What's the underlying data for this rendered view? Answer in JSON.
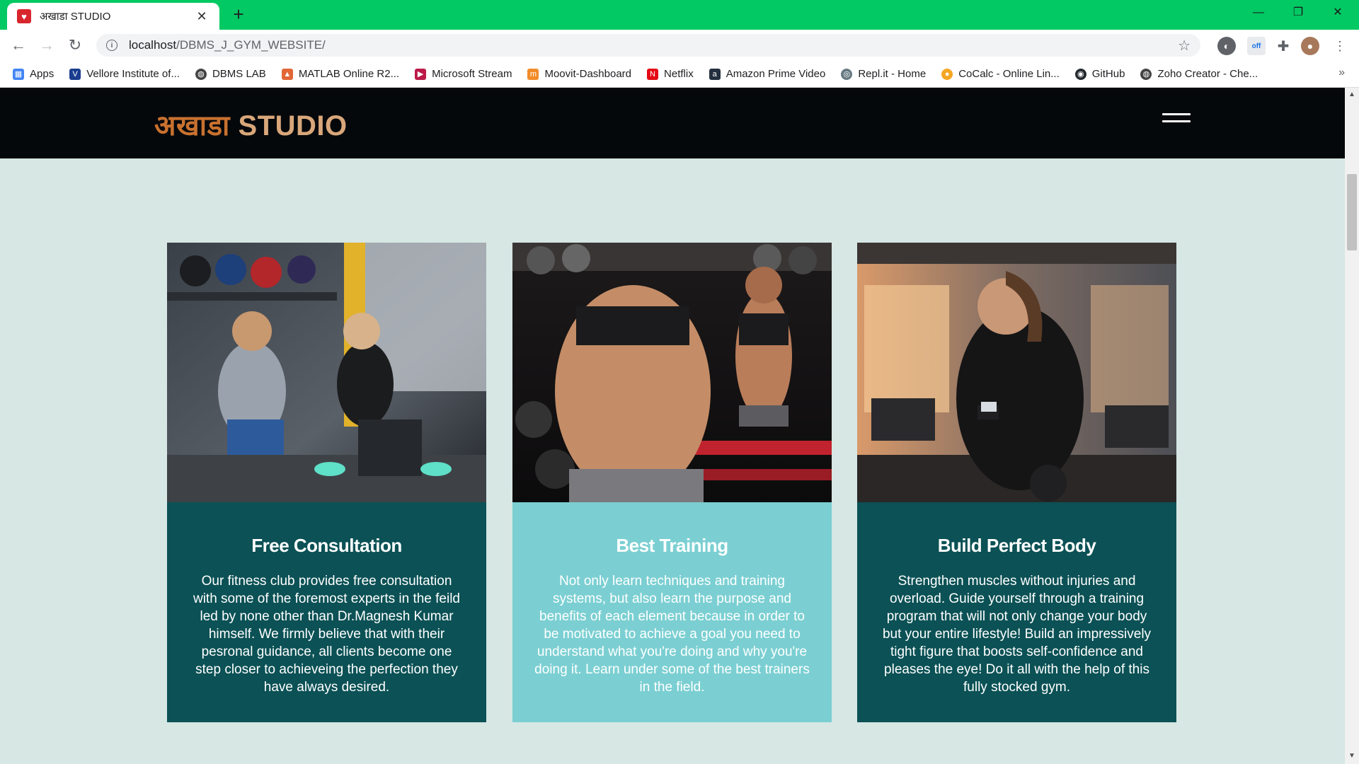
{
  "browser": {
    "tab_title": "अखाडा STUDIO",
    "tab_close": "✕",
    "new_tab": "+",
    "url_host": "localhost",
    "url_path": "/DBMS_J_GYM_WEBSITE/",
    "bookmarks": [
      {
        "label": "Apps",
        "icon": "apps-grid-icon",
        "color": "#4285f4"
      },
      {
        "label": "Vellore Institute of...",
        "icon": "vit-icon",
        "color": "#1a3d8f"
      },
      {
        "label": "DBMS LAB",
        "icon": "globe-icon",
        "color": "#444444"
      },
      {
        "label": "MATLAB Online R2...",
        "icon": "matlab-icon",
        "color": "#e16737"
      },
      {
        "label": "Microsoft Stream",
        "icon": "stream-icon",
        "color": "#bc1948"
      },
      {
        "label": "Moovit-Dashboard",
        "icon": "moovit-icon",
        "color": "#f28c28"
      },
      {
        "label": "Netflix",
        "icon": "netflix-icon",
        "color": "#e50914"
      },
      {
        "label": "Amazon Prime Video",
        "icon": "amazon-icon",
        "color": "#232f3e"
      },
      {
        "label": "Repl.it - Home",
        "icon": "replit-icon",
        "color": "#667881"
      },
      {
        "label": "CoCalc - Online Lin...",
        "icon": "cocalc-icon",
        "color": "#f5a623"
      },
      {
        "label": "GitHub",
        "icon": "github-icon",
        "color": "#24292e"
      },
      {
        "label": "Zoho Creator - Che...",
        "icon": "globe-icon",
        "color": "#444444"
      }
    ],
    "bookmarks_more": "»"
  },
  "site": {
    "logo_hindi": "अखाडा",
    "logo_studio": "STUDIO",
    "cards": [
      {
        "title": "Free Consultation",
        "text": "Our fitness club provides free consultation with some of the foremost experts in the feild led by none other than Dr.Magnesh Kumar himself. We firmly believe that with their pesronal guidance, all clients become one step closer to achieveing the perfection they have always desired.",
        "theme": "dark"
      },
      {
        "title": "Best Training",
        "text": "Not only learn techniques and training systems, but also learn the purpose and benefits of each element because in order to be motivated to achieve a goal you need to understand what you're doing and why you're doing it. Learn under some of the best trainers in the field.",
        "theme": "light"
      },
      {
        "title": "Build Perfect Body",
        "text": "Strengthen muscles without injuries and overload. Guide yourself through a training program that will not only change your body but your entire lifestyle! Build an impressively tight figure that boosts self-confidence and pleases the eye! Do it all with the help of this fully stocked gym.",
        "theme": "dark"
      }
    ]
  },
  "colors": {
    "browser_frame": "#02c963",
    "page_bg": "#d6e7e4",
    "header_bg": "#04080b",
    "card_dark": "#0b5155",
    "card_light": "#7bcfd2",
    "logo_orange": "#c9712f"
  }
}
